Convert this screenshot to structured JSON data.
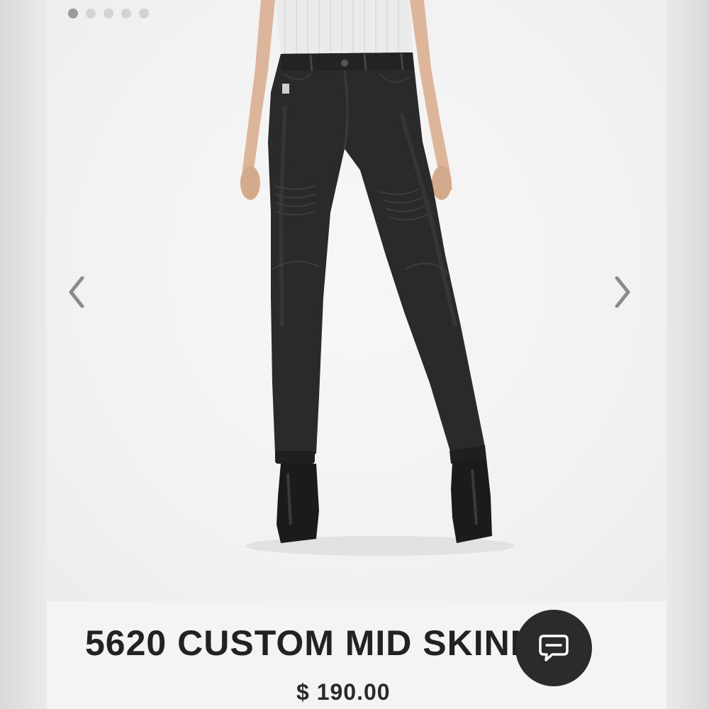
{
  "carousel": {
    "dot_count": 5,
    "active_index": 0,
    "prev_icon": "chevron-left-icon",
    "next_icon": "chevron-right-icon"
  },
  "product": {
    "title": "5620 CUSTOM MID SKINNY.",
    "price": "$ 190.00"
  },
  "chat": {
    "icon": "chat-bubble-icon",
    "background": "#2b2b2b"
  }
}
